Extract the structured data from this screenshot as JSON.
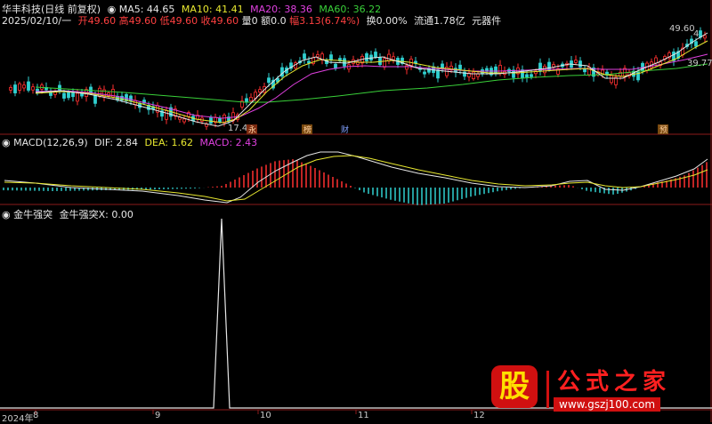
{
  "header": {
    "stock_name": "华丰科技(日线 前复权)",
    "ma5": "MA5: 44.65",
    "ma10": "MA10: 41.41",
    "ma20": "MA20: 38.36",
    "ma60": "MA60: 36.22",
    "date": "2025/02/10/一",
    "open": "开49.60",
    "high": "高49.60",
    "low": "低49.60",
    "close": "收49.60",
    "volume": "量0",
    "amount": "额0.0",
    "change": "幅3.13(6.74%)",
    "turnover": "换0.00%",
    "float_cap": "流通1.78亿",
    "sector": "元器件"
  },
  "price_labels": {
    "high_label": "49.60",
    "low_label": "17.40",
    "right_label": "39.77",
    "right_top": "4"
  },
  "event_markers": [
    "永",
    "榜",
    "财",
    "预"
  ],
  "macd_header": {
    "name": "MACD(12,26,9)",
    "dif": "DIF: 2.84",
    "dea": "DEA: 1.62",
    "macd": "MACD: 2.43"
  },
  "indicator_header": {
    "name": "金牛强突",
    "value_label": "金牛强突X: 0.00"
  },
  "x_axis": [
    "2024年",
    "8",
    "9",
    "10",
    "11",
    "12"
  ],
  "watermark": {
    "left": "股",
    "brand": "公式之家",
    "url": "www.gszj100.com"
  },
  "colors": {
    "up": "#ff3030",
    "down": "#30d0d0",
    "ma5": "#e6e6e6",
    "ma10": "#e8e830",
    "ma20": "#e040e0",
    "ma60": "#39d039"
  }
}
